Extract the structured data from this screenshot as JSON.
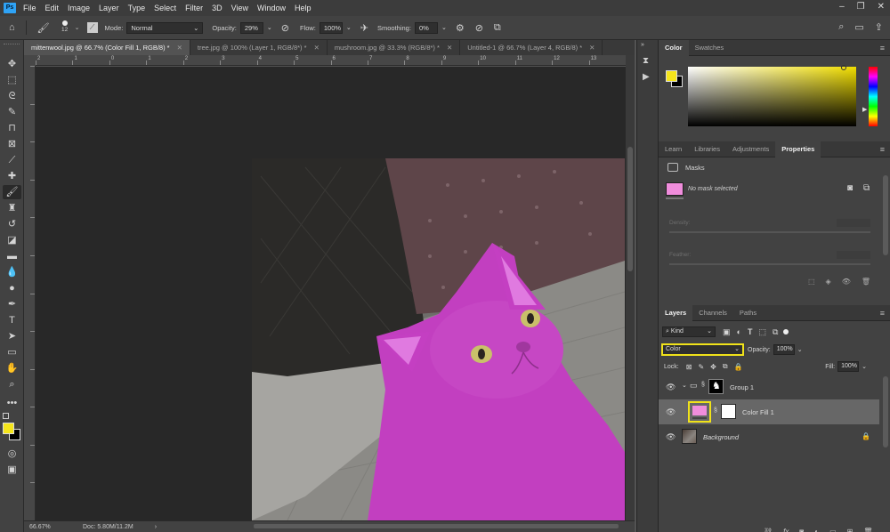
{
  "menu": {
    "logo": "Ps",
    "items": [
      "File",
      "Edit",
      "Image",
      "Layer",
      "Type",
      "Select",
      "Filter",
      "3D",
      "View",
      "Window",
      "Help"
    ]
  },
  "window_controls": {
    "minimize": "–",
    "restore": "❐",
    "close": "✕"
  },
  "options": {
    "brush_size": "12",
    "mode_label": "Mode:",
    "mode_value": "Normal",
    "opacity_label": "Opacity:",
    "opacity_value": "29%",
    "flow_label": "Flow:",
    "flow_value": "100%",
    "smoothing_label": "Smoothing:",
    "smoothing_value": "0%"
  },
  "tabs": [
    {
      "label": "mittenwool.jpg @ 66.7% (Color Fill 1, RGB/8) *",
      "close": "✕"
    },
    {
      "label": "tree.jpg @ 100% (Layer 1, RGB/8*) *",
      "close": "✕"
    },
    {
      "label": "mushroom.jpg @ 33.3% (RGB/8*) *",
      "close": "✕"
    },
    {
      "label": "Untitled-1 @ 66.7% (Layer 4, RGB/8) *",
      "close": "✕"
    }
  ],
  "status": {
    "zoom": "66.67%",
    "doc": "Doc: 5.80M/11.2M",
    "arrow": "›"
  },
  "ruler_ticks": [
    "2",
    "1",
    "0",
    "1",
    "2",
    "3",
    "4",
    "5",
    "6",
    "7",
    "8",
    "9",
    "10",
    "11",
    "12",
    "13"
  ],
  "color_panel": {
    "tabs": [
      "Color",
      "Swatches"
    ],
    "foreground": "#f5e51b",
    "background": "#000000"
  },
  "properties_panel": {
    "tabs": [
      "Learn",
      "Libraries",
      "Adjustments",
      "Properties"
    ],
    "section": "Masks",
    "no_mask": "No mask selected",
    "density_label": "Density:",
    "feather_label": "Feather:"
  },
  "layers_panel": {
    "tabs": [
      "Layers",
      "Channels",
      "Paths"
    ],
    "filter_kind": "Kind",
    "blend_mode": "Color",
    "opacity_label": "Opacity:",
    "opacity_value": "100%",
    "lock_label": "Lock:",
    "fill_label": "Fill:",
    "fill_value": "100%",
    "layers": [
      {
        "name": "Group 1",
        "type": "group"
      },
      {
        "name": "Color Fill 1",
        "type": "fill",
        "fill_color": "#f08ddc",
        "selected": true
      },
      {
        "name": "Background",
        "type": "background"
      }
    ]
  },
  "colors": {
    "accent_highlight": "#f0e21a",
    "fill_pink": "#f08ddc",
    "cat_magenta": "#c23fc0"
  }
}
